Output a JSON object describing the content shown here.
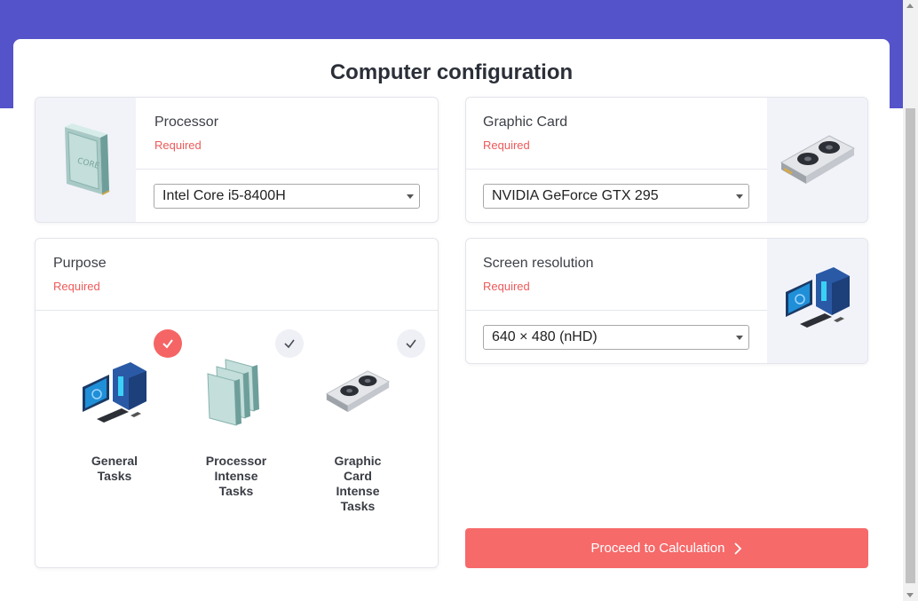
{
  "page": {
    "title": "Computer configuration"
  },
  "processor": {
    "label": "Processor",
    "required": "Required",
    "selected": "Intel Core i5-8400H"
  },
  "graphic_card": {
    "label": "Graphic Card",
    "required": "Required",
    "selected": "NVIDIA GeForce GTX 295"
  },
  "purpose": {
    "label": "Purpose",
    "required": "Required",
    "items": [
      {
        "lines": [
          "General",
          "Tasks"
        ],
        "checked": true
      },
      {
        "lines": [
          "Processor",
          "Intense",
          "Tasks"
        ],
        "checked": false
      },
      {
        "lines": [
          "Graphic",
          "Card",
          "Intense",
          "Tasks"
        ],
        "checked": false
      }
    ]
  },
  "screen_resolution": {
    "label": "Screen resolution",
    "required": "Required",
    "selected": "640 × 480 (nHD)"
  },
  "actions": {
    "proceed_label": "Proceed to Calculation"
  },
  "colors": {
    "brand": "#5553c9",
    "accent": "#f66a6a",
    "required": "#ee5a5a"
  }
}
